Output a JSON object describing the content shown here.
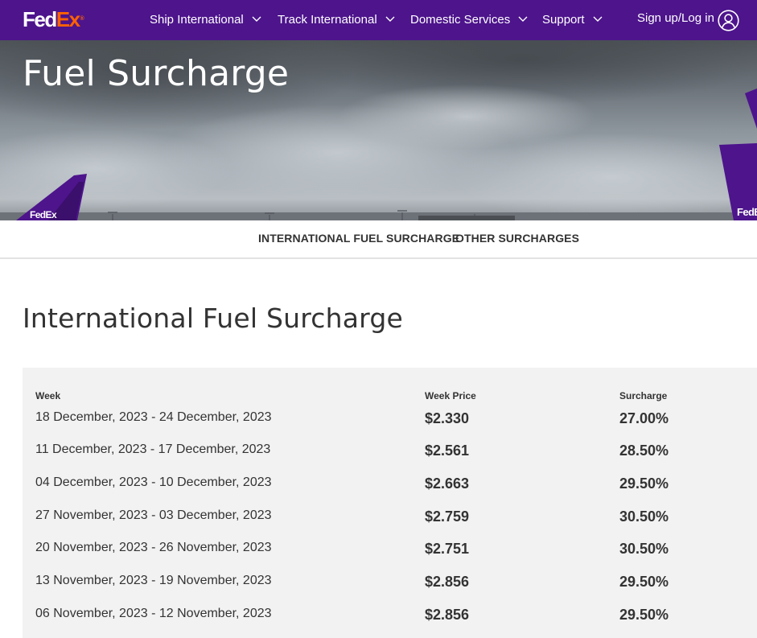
{
  "header": {
    "logo": {
      "part1": "Fed",
      "part2": "Ex",
      "mark": "®"
    },
    "nav": [
      {
        "label": "Ship International",
        "icon": "chevron-down-icon"
      },
      {
        "label": "Track International",
        "icon": "chevron-down-icon"
      },
      {
        "label": "Domestic Services",
        "icon": "chevron-down-icon"
      },
      {
        "label": "Support",
        "icon": "chevron-down-icon"
      }
    ],
    "login_label": "Sign up/Log in",
    "user_icon": "user-icon",
    "colors": {
      "brand_purple": "#4d148c",
      "brand_orange": "#ff6200"
    }
  },
  "hero": {
    "title": "Fuel Surcharge",
    "tail_text": "FedEx"
  },
  "subnav": {
    "links": [
      "INTERNATIONAL FUEL SURCHARGE",
      "OTHER SURCHARGES"
    ]
  },
  "main": {
    "section_title": "International Fuel Surcharge",
    "table": {
      "headers": {
        "week": "Week",
        "price": "Week Price",
        "surcharge": "Surcharge"
      },
      "rows": [
        {
          "week": "18 December, 2023 - 24 December, 2023",
          "price": "$2.330",
          "surcharge": "27.00%"
        },
        {
          "week": "11 December, 2023 - 17 December, 2023",
          "price": "$2.561",
          "surcharge": "28.50%"
        },
        {
          "week": "04 December, 2023 - 10 December, 2023",
          "price": "$2.663",
          "surcharge": "29.50%"
        },
        {
          "week": "27 November, 2023 - 03 December, 2023",
          "price": "$2.759",
          "surcharge": "30.50%"
        },
        {
          "week": "20 November, 2023 - 26 November, 2023",
          "price": "$2.751",
          "surcharge": "30.50%"
        },
        {
          "week": "13 November, 2023 - 19 November, 2023",
          "price": "$2.856",
          "surcharge": "29.50%"
        },
        {
          "week": "06 November, 2023 - 12 November, 2023",
          "price": "$2.856",
          "surcharge": "29.50%"
        }
      ]
    }
  }
}
